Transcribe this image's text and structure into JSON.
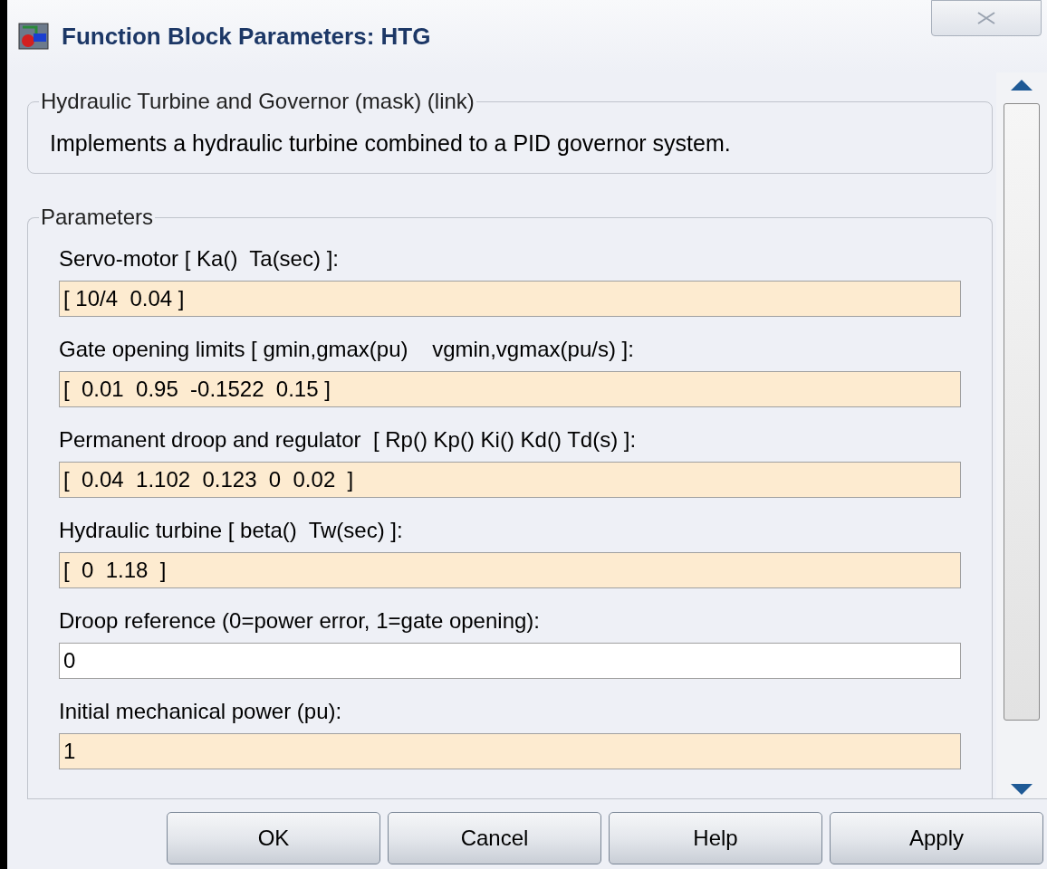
{
  "window": {
    "title": "Function Block Parameters: HTG"
  },
  "description": {
    "legend": "Hydraulic Turbine and Governor (mask) (link)",
    "text": "Implements a hydraulic turbine combined to a PID governor system."
  },
  "parameters": {
    "legend": "Parameters",
    "fields": [
      {
        "label": "Servo-motor [ Ka()  Ta(sec) ]:",
        "value": "[ 10/4  0.04 ]",
        "highlighted": true
      },
      {
        "label": "Gate opening limits [ gmin,gmax(pu)    vgmin,vgmax(pu/s) ]:",
        "value": "[  0.01  0.95  -0.1522  0.15 ]",
        "highlighted": true
      },
      {
        "label": "Permanent droop and regulator  [ Rp() Kp() Ki() Kd() Td(s) ]:",
        "value": "[  0.04  1.102  0.123  0  0.02  ]",
        "highlighted": true
      },
      {
        "label": "Hydraulic turbine [ beta()  Tw(sec) ]:",
        "value": "[  0  1.18  ]",
        "highlighted": true
      },
      {
        "label": "Droop reference (0=power error, 1=gate opening):",
        "value": "0",
        "highlighted": false
      },
      {
        "label": "Initial mechanical power (pu):",
        "value": "1",
        "highlighted": true
      }
    ]
  },
  "buttons": [
    "OK",
    "Cancel",
    "Help",
    "Apply"
  ]
}
